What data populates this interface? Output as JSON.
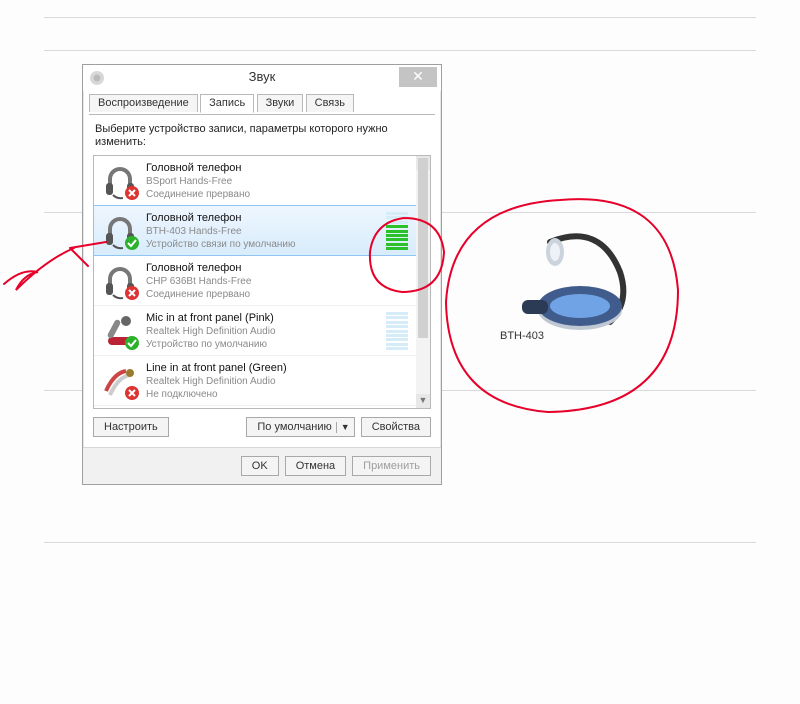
{
  "dialog": {
    "title": "Звук",
    "tabs": [
      "Воспроизведение",
      "Запись",
      "Звуки",
      "Связь"
    ],
    "active_tab": 1,
    "prompt": "Выберите устройство записи, параметры которого нужно изменить:",
    "configure_btn": "Настроить",
    "default_btn": "По умолчанию",
    "properties_btn": "Свойства",
    "ok_btn": "OK",
    "cancel_btn": "Отмена",
    "apply_btn": "Применить"
  },
  "devices": [
    {
      "name": "Головной телефон",
      "driver": "BSport Hands-Free",
      "status": "Соединение прервано",
      "badge": "disconnected",
      "level": 0
    },
    {
      "name": "Головной телефон",
      "driver": "BTH-403 Hands-Free",
      "status": "Устройство связи по умолчанию",
      "badge": "default-comm",
      "level": 6,
      "selected": true
    },
    {
      "name": "Головной телефон",
      "driver": "CHP 636Bt Hands-Free",
      "status": "Соединение прервано",
      "badge": "disconnected",
      "level": 0
    },
    {
      "name": "Mic in at front panel (Pink)",
      "driver": "Realtek High Definition Audio",
      "status": "Устройство по умолчанию",
      "badge": "default",
      "level": 0,
      "meter": true
    },
    {
      "name": "Line in at front panel (Green)",
      "driver": "Realtek High Definition Audio",
      "status": "Не подключено",
      "badge": "disconnected",
      "level": 0
    }
  ],
  "bt_overlay": {
    "label": "BTH-403"
  },
  "colors": {
    "annotation": "#e6002a",
    "selected_bg": "#d8ecfc",
    "accent_green": "#2bc12b"
  }
}
